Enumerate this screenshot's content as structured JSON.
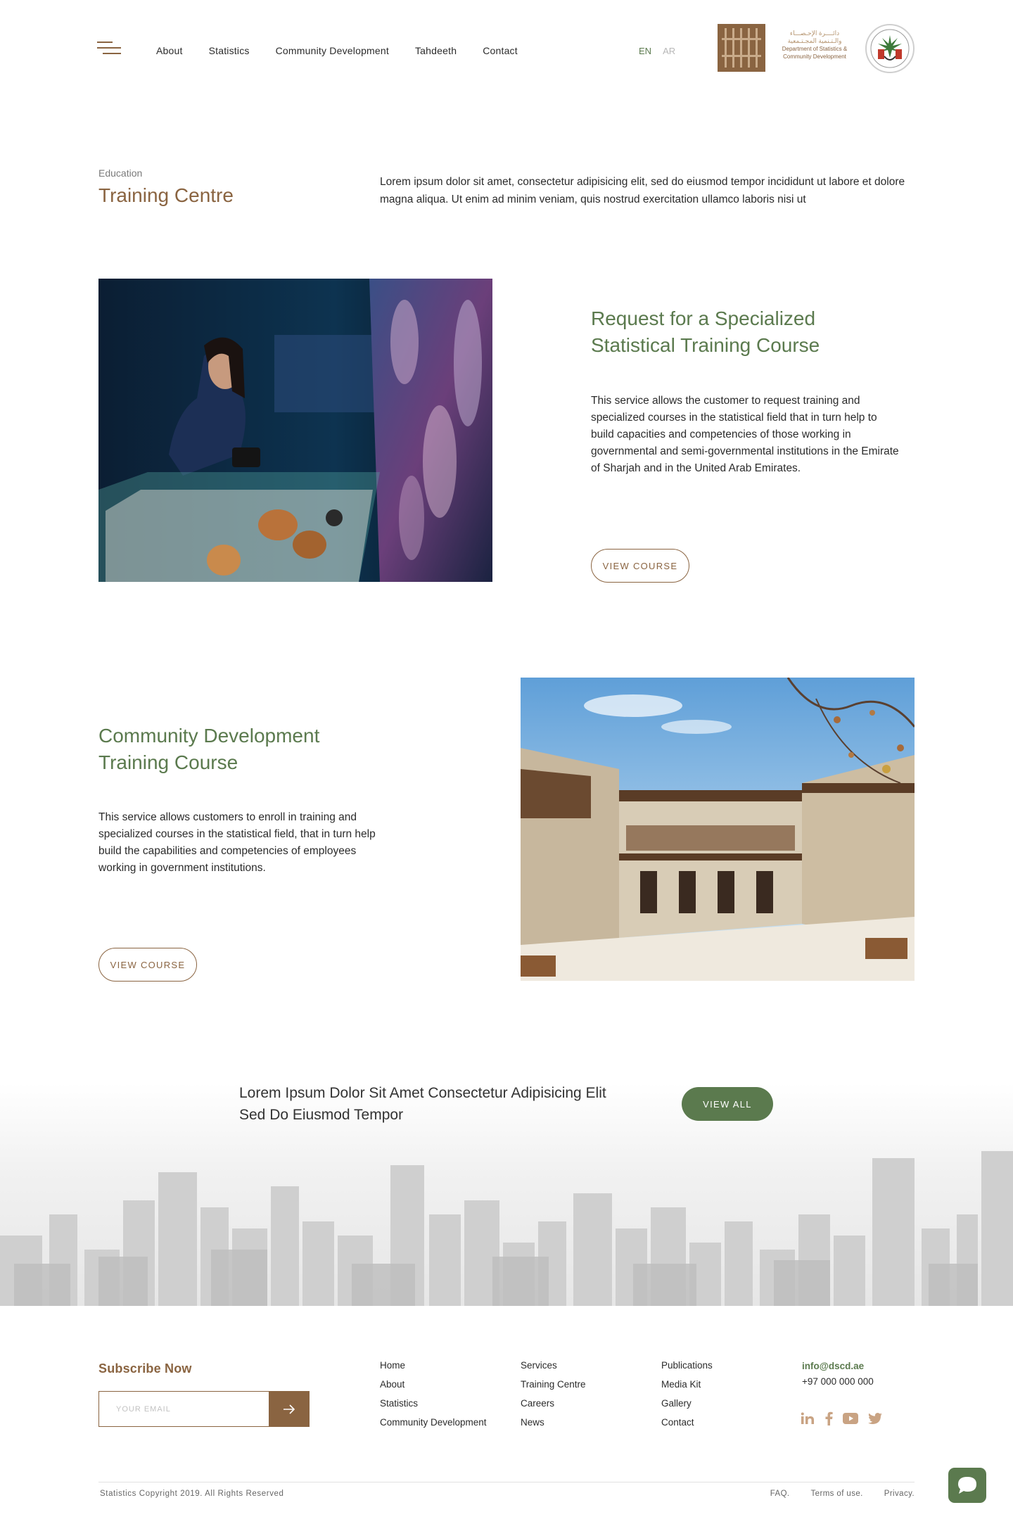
{
  "header": {
    "nav": [
      "About",
      "Statistics",
      "Community Development",
      "Tahdeeth",
      "Contact"
    ],
    "lang_en": "EN",
    "lang_ar": "AR",
    "logo_ar_1": "دائــــرة الإحـصـــاء",
    "logo_ar_2": "والـتـنمية المجـتـمعية",
    "logo_en_1": "Department of Statistics &",
    "logo_en_2": "Community Development"
  },
  "intro": {
    "kicker": "Education",
    "title": "Training Centre",
    "text": "Lorem ipsum dolor sit amet, consectetur adipisicing elit, sed do eiusmod tempor incididunt ut labore et dolore magna aliqua. Ut enim ad minim veniam, quis nostrud exercitation ullamco laboris nisi ut"
  },
  "courses": [
    {
      "title_1": "Request for a Specialized",
      "title_2": "Statistical Training Course",
      "text": "This service allows the customer to request training and specialized courses in the statistical field that in turn help to build capacities and competencies of those working in governmental and semi-governmental institutions in the Emirate of Sharjah and in the United Arab Emirates.",
      "button": "VIEW COURSE"
    },
    {
      "title_1": "Community Development",
      "title_2": "Training Course",
      "text": "This service allows customers to enroll in training and specialized courses in the statistical field, that in turn help build the capabilities and competencies  of employees working in government institutions.",
      "button": "VIEW COURSE"
    }
  ],
  "cta": {
    "line_1": "Lorem Ipsum Dolor Sit Amet Consectetur Adipisicing Elit",
    "line_2": "Sed Do Eiusmod Tempor",
    "button": "VIEW ALL"
  },
  "footer": {
    "subscribe_title": "Subscribe Now",
    "email_placeholder": "YOUR EMAIL",
    "col1": [
      "Home",
      "About",
      "Statistics",
      "Community Development"
    ],
    "col2": [
      "Services",
      "Training Centre",
      "Careers",
      "News"
    ],
    "col3": [
      "Publications",
      "Media Kit",
      "Gallery",
      "Contact"
    ],
    "email": "info@dscd.ae",
    "phone": "+97 000 000 000",
    "socials": [
      "linkedin-icon",
      "facebook-icon",
      "youtube-icon",
      "twitter-icon"
    ],
    "copyright": "Statistics Copyright 2019. All Rights Reserved",
    "legal": [
      "FAQ.",
      "Terms of use.",
      "Privacy."
    ]
  },
  "colors": {
    "brand_brown": "#8a6441",
    "brand_green": "#5b7a4e"
  }
}
